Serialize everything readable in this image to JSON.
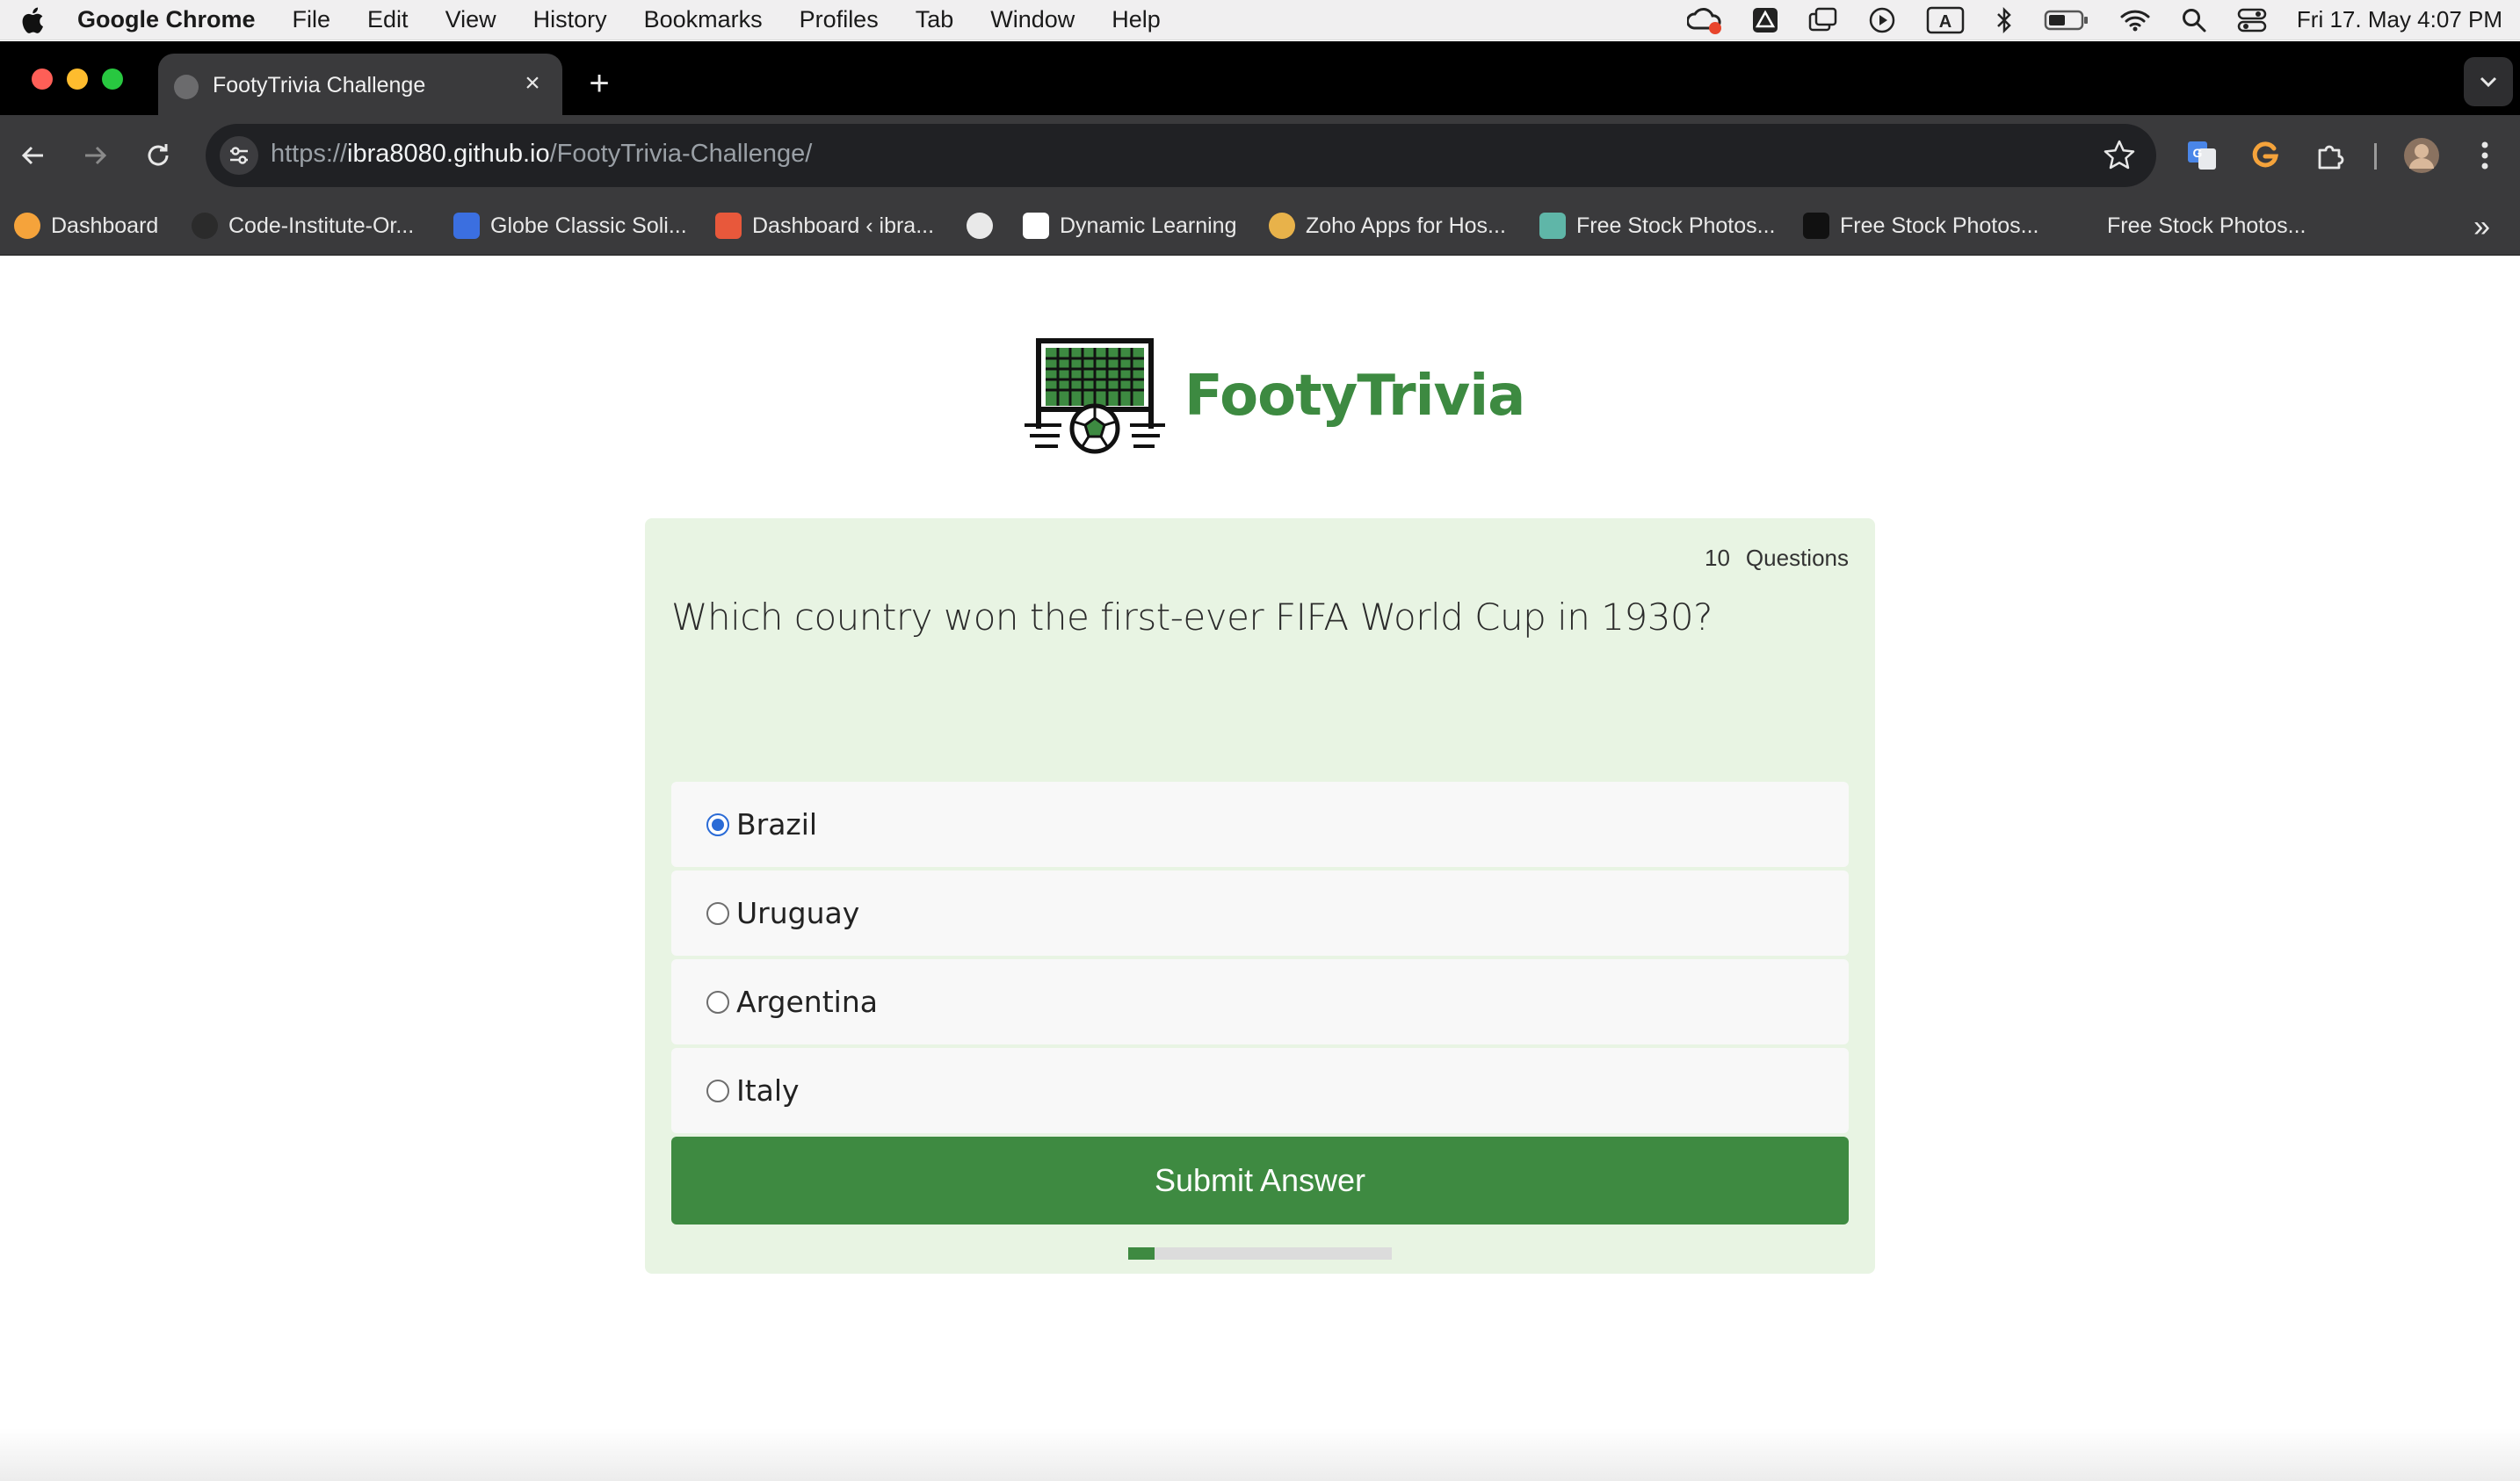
{
  "menubar": {
    "items": [
      "Google Chrome",
      "File",
      "Edit",
      "View",
      "History",
      "Bookmarks",
      "Profiles",
      "Tab",
      "Window",
      "Help"
    ],
    "clock": "Fri 17. May  4:07 PM"
  },
  "tab": {
    "title": "FootyTrivia Challenge"
  },
  "toolbar": {
    "url_prefix": "https://",
    "url_host": "ibra8080.github.io",
    "url_path": "/FootyTrivia-Challenge/"
  },
  "bookmarks": [
    {
      "label": "Dashboard",
      "color": "#f5a33b"
    },
    {
      "label": "Code-Institute-Or...",
      "color": "#2b2b2b"
    },
    {
      "label": "Globe Classic Soli...",
      "color": "#3b6fe0"
    },
    {
      "label": "Dashboard ‹ ibra...",
      "color": "#e8583b"
    },
    {
      "label": "",
      "color": "#ffffff"
    },
    {
      "label": "Dynamic Learning",
      "color": "#ffffff"
    },
    {
      "label": "Zoho Apps for Hos...",
      "color": "#e8b24a"
    },
    {
      "label": "Free Stock Photos...",
      "color": "#5fb6a8"
    },
    {
      "label": "Free Stock Photos...",
      "color": "#111111"
    },
    {
      "label": "Free Stock Photos...",
      "color": ""
    }
  ],
  "app": {
    "brand": "FootyTrivia",
    "question_count": "10",
    "question_count_label": "Questions",
    "question": "Which country won the first-ever FIFA World Cup in 1930?",
    "answers": [
      "Brazil",
      "Uruguay",
      "Argentina",
      "Italy"
    ],
    "selected_answer": "Brazil",
    "submit_label": "Submit Answer",
    "progress_fraction": 0.1,
    "accent": "#3e8a41"
  }
}
